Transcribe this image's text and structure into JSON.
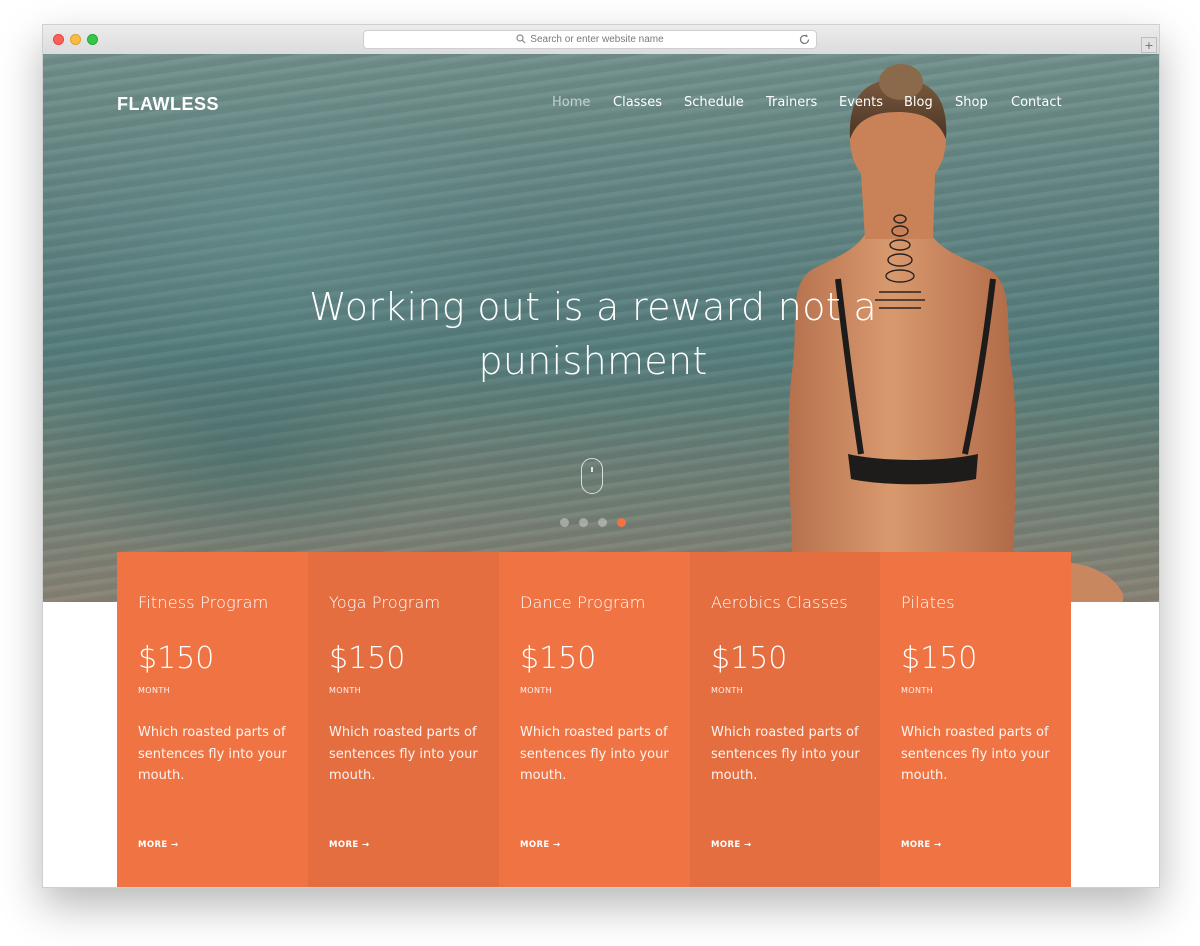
{
  "browser": {
    "url_placeholder": "Search or enter website name",
    "new_tab_label": "+"
  },
  "site": {
    "logo": "FLAWLESS",
    "nav": [
      {
        "label": "Home",
        "active": true
      },
      {
        "label": "Classes",
        "active": false
      },
      {
        "label": "Schedule",
        "active": false
      },
      {
        "label": "Trainers",
        "active": false
      },
      {
        "label": "Events",
        "active": false
      },
      {
        "label": "Blog",
        "active": false
      },
      {
        "label": "Shop",
        "active": false
      },
      {
        "label": "Contact",
        "active": false
      }
    ]
  },
  "hero": {
    "headline_line1": "Working out is a reward not a",
    "headline_line2": "punishment",
    "slider_count": 4,
    "active_slide": 4
  },
  "pricing": [
    {
      "title": "Fitness Program",
      "price": "$150",
      "period": "MONTH",
      "description": "Which roasted parts of sentences fly into your mouth.",
      "more": "MORE",
      "color": "#f07443"
    },
    {
      "title": "Yoga Program",
      "price": "$150",
      "period": "MONTH",
      "description": "Which roasted parts of sentences fly into your mouth.",
      "more": "MORE",
      "color": "#e56e40"
    },
    {
      "title": "Dance Program",
      "price": "$150",
      "period": "MONTH",
      "description": "Which roasted parts of sentences fly into your mouth.",
      "more": "MORE",
      "color": "#f07443"
    },
    {
      "title": "Aerobics Classes",
      "price": "$150",
      "period": "MONTH",
      "description": "Which roasted parts of sentences fly into your mouth.",
      "more": "MORE",
      "color": "#e56e40"
    },
    {
      "title": "Pilates",
      "price": "$150",
      "period": "MONTH",
      "description": "Which roasted parts of sentences fly into your mouth.",
      "more": "MORE",
      "color": "#f07443"
    }
  ],
  "colors": {
    "accent": "#f07443",
    "accent_dark": "#e56e40"
  },
  "icons": {
    "more_arrow": "→"
  }
}
